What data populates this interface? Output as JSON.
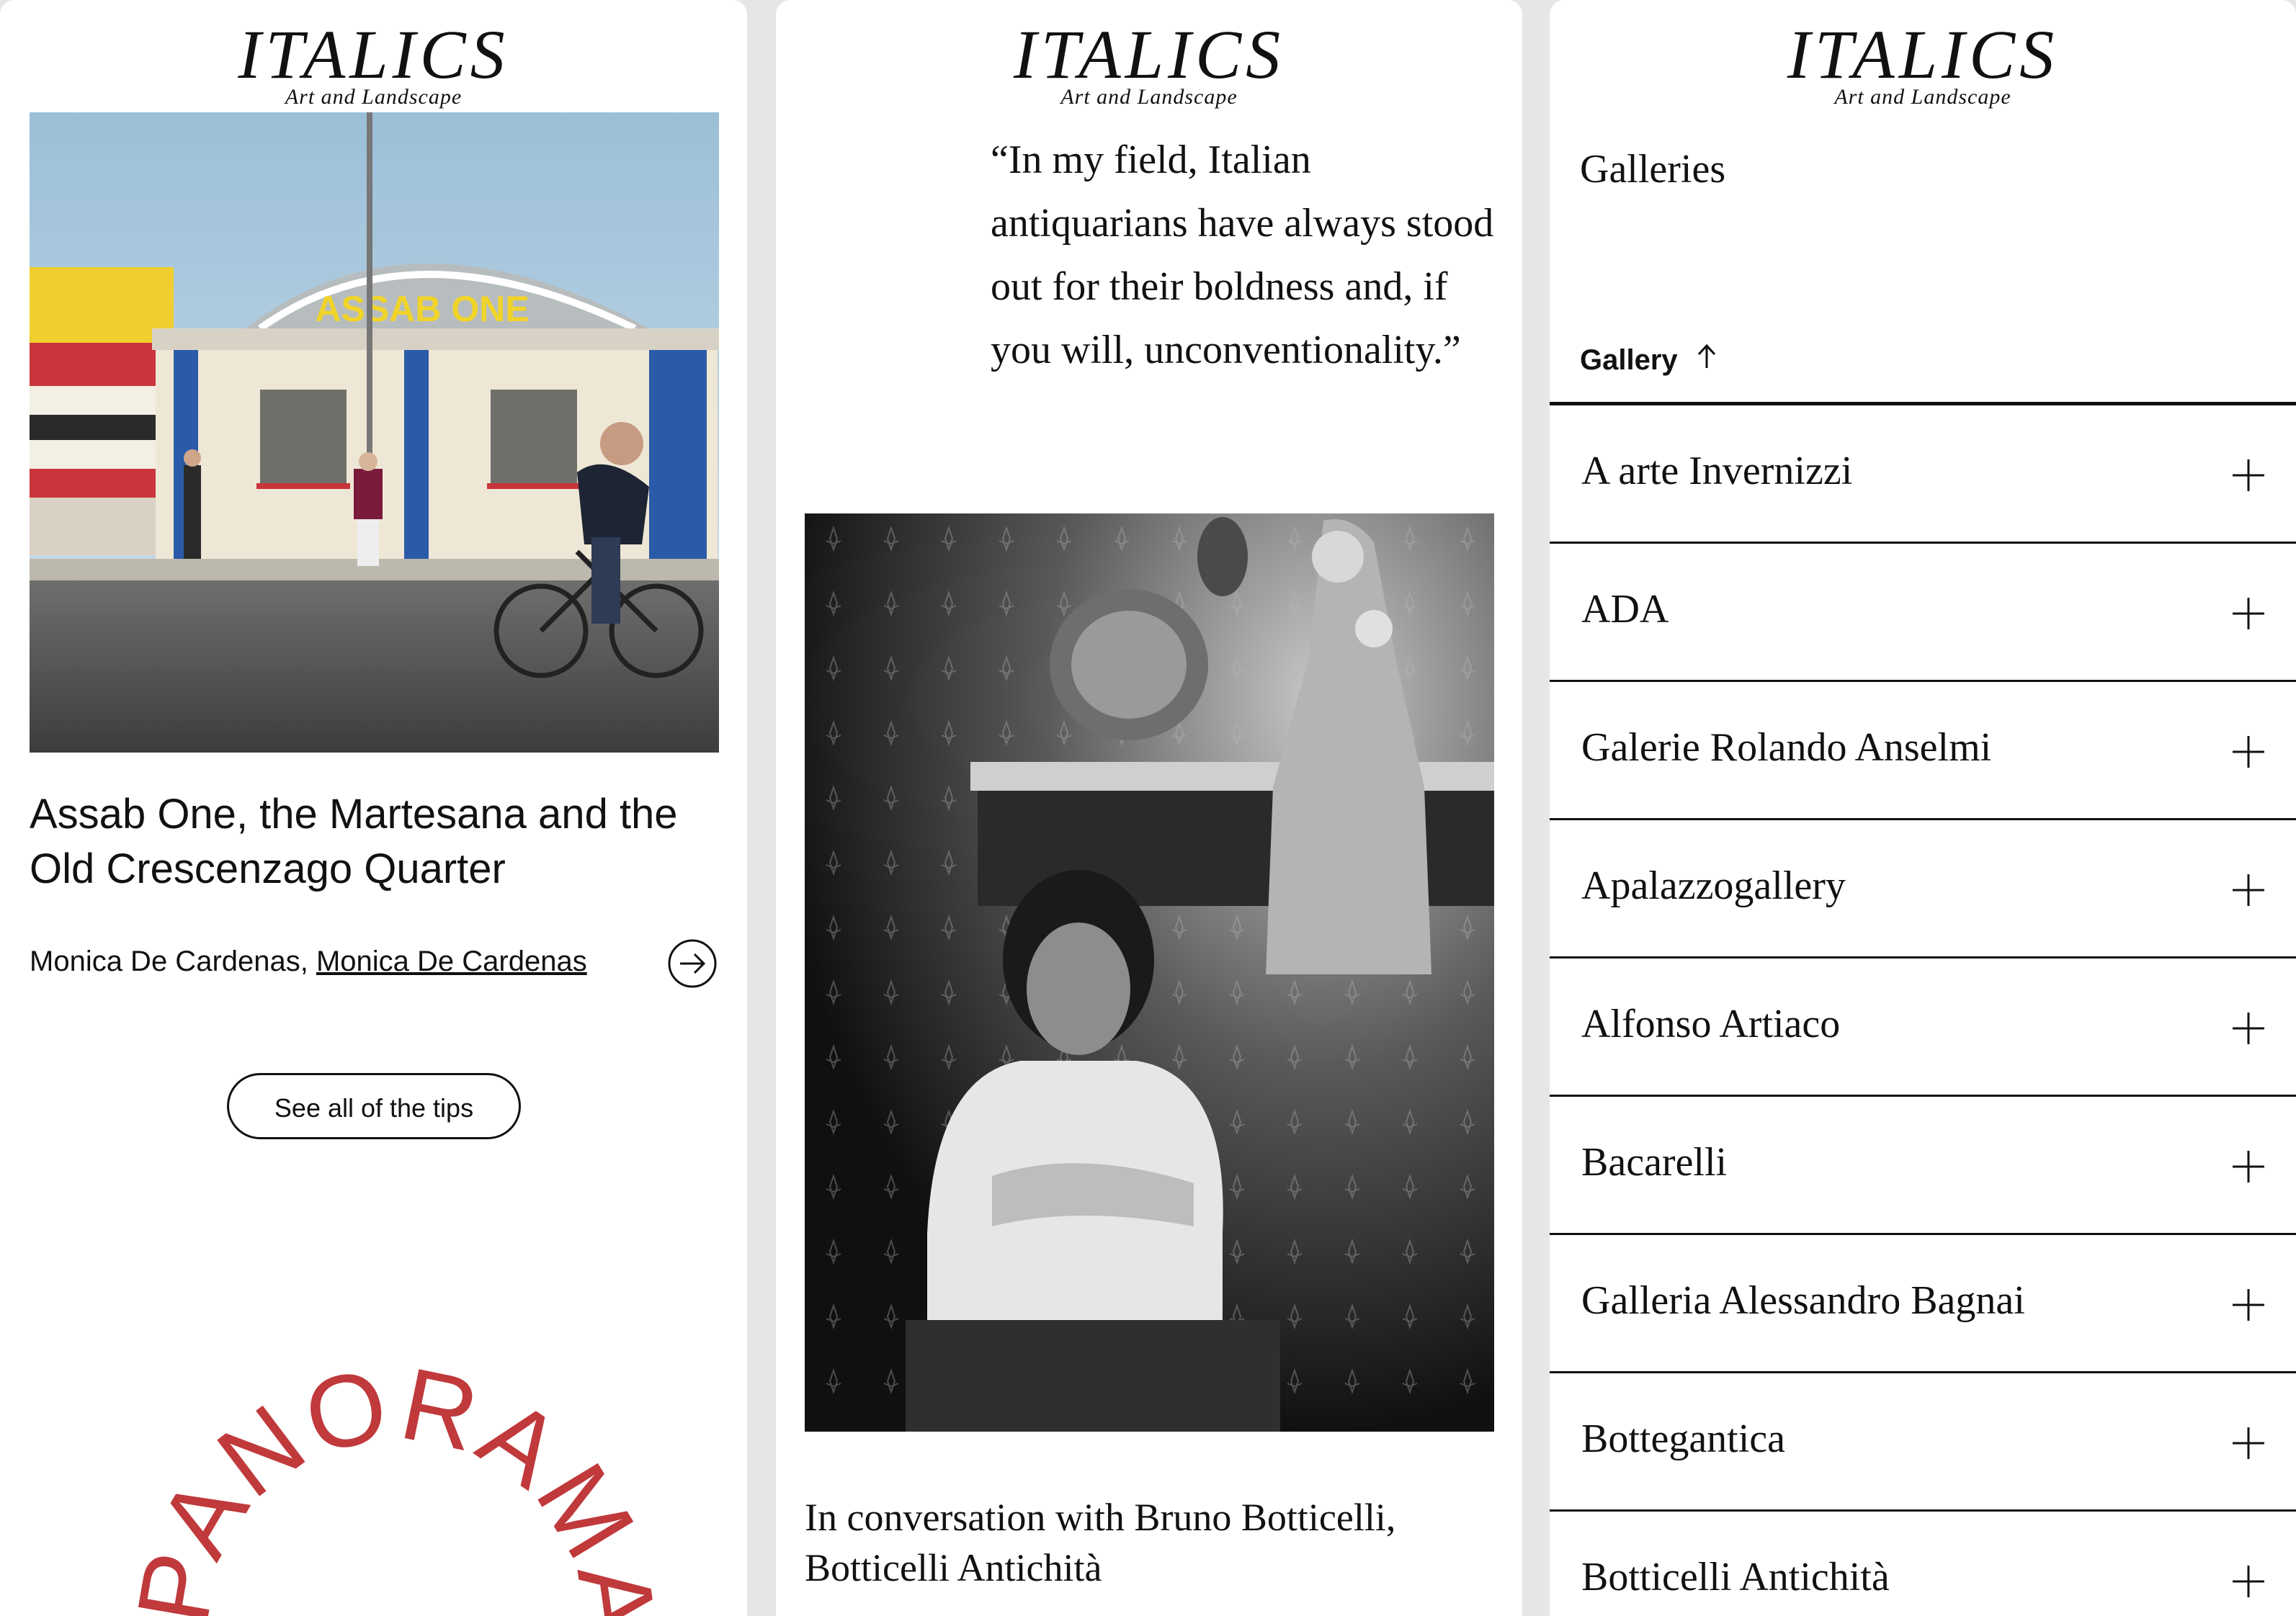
{
  "brand": {
    "wordmark": "ITALICS",
    "tagline": "Art and Landscape"
  },
  "panel1": {
    "photo_sign_text": "ASSAB ONE",
    "article_title": "Assab One, the Martesana and the Old Crescenzago Quarter",
    "byline_author": "Monica De Cardenas,",
    "byline_link": "Monica De Cardenas",
    "see_all_button": "See all of the tips",
    "panorama_text": "PANORAMA MON",
    "accent_color": "#c0393b"
  },
  "panel2": {
    "quote": "“In my field, Italian antiquarians have always stood out for their boldness and, if you will, unconventionality.”",
    "caption": "In conversation with Bruno Botticelli, Botticelli Antichità"
  },
  "panel3": {
    "heading": "Galleries",
    "sort_label": "Gallery",
    "sort_icon": "arrow-up-icon",
    "galleries": [
      {
        "name": "A arte Invernizzi"
      },
      {
        "name": "ADA"
      },
      {
        "name": "Galerie Rolando Anselmi"
      },
      {
        "name": "Apalazzogallery"
      },
      {
        "name": "Alfonso Artiaco"
      },
      {
        "name": "Bacarelli"
      },
      {
        "name": "Galleria Alessandro Bagnai"
      },
      {
        "name": "Bottegantica"
      },
      {
        "name": "Botticelli Antichità"
      }
    ]
  }
}
